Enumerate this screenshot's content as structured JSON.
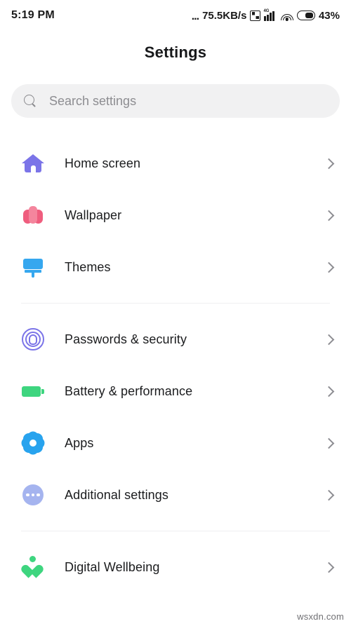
{
  "statusbar": {
    "time": "5:19 PM",
    "dots": "...",
    "network_speed": "75.5KB/s",
    "sim_icon": "sim-card-icon",
    "network_type": "4G",
    "signal_icon": "cellular-signal-icon",
    "wifi_icon": "wifi-icon",
    "battery_icon": "battery-icon",
    "battery_percent": "43%"
  },
  "header": {
    "title": "Settings"
  },
  "search": {
    "icon": "search-icon",
    "placeholder": "Search settings",
    "value": ""
  },
  "groups": [
    {
      "items": [
        {
          "label": "Home screen",
          "icon": "home-icon",
          "chevron": "chevron-right-icon"
        },
        {
          "label": "Wallpaper",
          "icon": "tulip-icon",
          "chevron": "chevron-right-icon"
        },
        {
          "label": "Themes",
          "icon": "paintbrush-icon",
          "chevron": "chevron-right-icon"
        }
      ]
    },
    {
      "items": [
        {
          "label": "Passwords & security",
          "icon": "fingerprint-icon",
          "chevron": "chevron-right-icon"
        },
        {
          "label": "Battery & performance",
          "icon": "battery-icon",
          "chevron": "chevron-right-icon"
        },
        {
          "label": "Apps",
          "icon": "gear-icon",
          "chevron": "chevron-right-icon"
        },
        {
          "label": "Additional settings",
          "icon": "more-dots-icon",
          "chevron": "chevron-right-icon"
        }
      ]
    },
    {
      "items": [
        {
          "label": "Digital Wellbeing",
          "icon": "heart-person-icon",
          "chevron": "chevron-right-icon"
        }
      ]
    }
  ],
  "watermark": "wsxdn.com",
  "colors": {
    "background": "#ffffff",
    "search_field": "#f1f1f2",
    "text_primary": "#1b1c1e",
    "text_placeholder": "#8d8d91",
    "divider": "#efeff1",
    "chevron": "#8e8e93",
    "icon_home": "#7b74e8",
    "icon_tulip": "#ef5d7e",
    "icon_brush": "#35a7ef",
    "icon_fingerprint": "#7b74e8",
    "icon_battery": "#3ed57f",
    "icon_gear": "#28a3ee",
    "icon_dots": "#a5b4ef",
    "icon_heart": "#3ed57f"
  }
}
